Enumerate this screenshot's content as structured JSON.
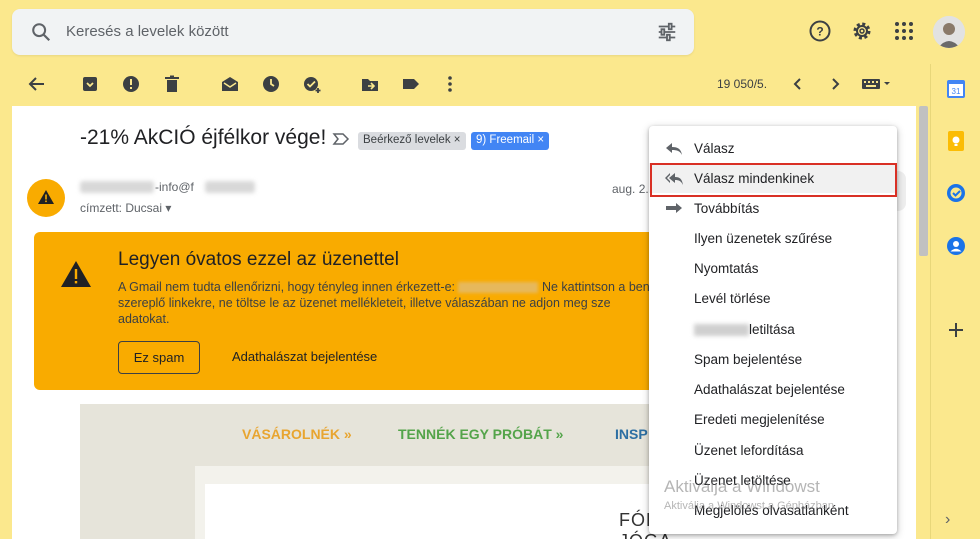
{
  "search": {
    "placeholder": "Keresés a levelek között"
  },
  "toolbar": {
    "count": "19 050/5."
  },
  "mail": {
    "subject": "-21% AkCIÓ éjfélkor vége!",
    "labels": [
      "Beérkező levelek",
      "9) Freemail"
    ],
    "sender_email_fragment": "-info@f",
    "recipient": "címzett: Ducsai",
    "date": "aug. 2."
  },
  "warning": {
    "title": "Legyen óvatos ezzel az üzenettel",
    "text_part1": "A Gmail nem tudta ellenőrizni, hogy tényleg innen érkezett-e:",
    "text_part2": "Ne kattintson a benne",
    "text_line2": "szereplő linkekre, ne töltse le az üzenet mellékleteit, illetve válaszában ne adjon meg sze",
    "text_line3": "adatokat.",
    "spam_button": "Ez spam",
    "report_button": "Adathalászat bejelentése"
  },
  "email_body": {
    "nav_shop": "VÁSÁROLNÉK »",
    "nav_try": "TENNÉK EGY PRÓBÁT »",
    "nav_insp": "INSP",
    "folia": "FÓLIÁS JÓGA"
  },
  "menu": {
    "items": [
      {
        "label": "Válasz",
        "icon": "reply-icon"
      },
      {
        "label": "Válasz mindenkinek",
        "icon": "reply-all-icon"
      },
      {
        "label": "Továbbítás",
        "icon": "forward-icon"
      },
      {
        "label": "Ilyen üzenetek szűrése"
      },
      {
        "label": "Nyomtatás"
      },
      {
        "label": "Levél törlése"
      },
      {
        "label": "letiltása"
      },
      {
        "label": "Spam bejelentése"
      },
      {
        "label": "Adathalászat bejelentése"
      },
      {
        "label": "Eredeti megjelenítése"
      },
      {
        "label": "Üzenet lefordítása"
      },
      {
        "label": "Üzenet letöltése"
      },
      {
        "label": "Megjelölés olvasatlanként"
      }
    ]
  },
  "watermark": {
    "title": "Aktiválja a Windowst",
    "subtitle": "Aktiválja a Windowst a Gépházban."
  },
  "colors": {
    "background": "#fbe88d",
    "warning": "#f9ab00",
    "highlight_border": "#d93025",
    "label_blue": "#4285f4"
  }
}
